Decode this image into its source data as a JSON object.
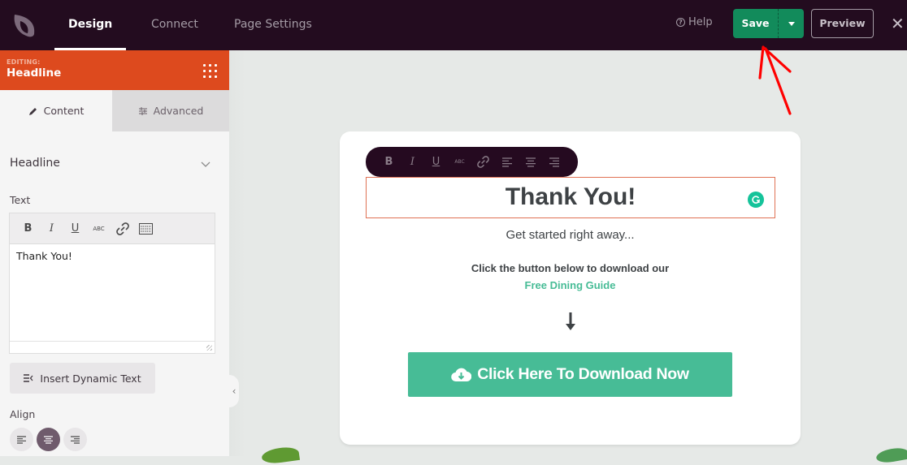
{
  "topbar": {
    "logo": "leaf-logo-icon",
    "tabs": [
      {
        "label": "Design",
        "active": true
      },
      {
        "label": "Connect",
        "active": false
      },
      {
        "label": "Page Settings",
        "active": false
      }
    ],
    "help_label": "Help",
    "save_label": "Save",
    "preview_label": "Preview",
    "close_glyph": "✕"
  },
  "sidebar": {
    "editing_label": "EDITING:",
    "editing_title": "Headline",
    "panel_tabs": [
      {
        "label": "Content",
        "icon": "pencil-icon",
        "active": true
      },
      {
        "label": "Advanced",
        "icon": "sliders-icon",
        "active": false
      }
    ],
    "section_title": "Headline",
    "text_label": "Text",
    "editor_toolbar": [
      "B",
      "I",
      "U",
      "ABC",
      "link",
      "keyboard"
    ],
    "editor_value": "Thank You!",
    "dynamic_text_label": "Insert Dynamic Text",
    "align_label": "Align",
    "align_options": [
      "left",
      "center",
      "right"
    ],
    "align_selected": "center"
  },
  "canvas": {
    "floating_toolbar": [
      "B",
      "I",
      "U",
      "ABC",
      "link",
      "align-left",
      "align-center",
      "align-right"
    ],
    "headline": "Thank You!",
    "subheadline": "Get started right away...",
    "body_line": "Click the button below to download our",
    "link_text": "Free Dining Guide",
    "down_arrow": "🡓",
    "cta_label": "Click Here To Download Now"
  },
  "colors": {
    "topbar_bg": "#230c1f",
    "save_green": "#128b5b",
    "editing_orange": "#dd4a1e",
    "cta_green": "#47bc96",
    "link_green": "#47bc96",
    "annotation_red": "#ff0000"
  }
}
